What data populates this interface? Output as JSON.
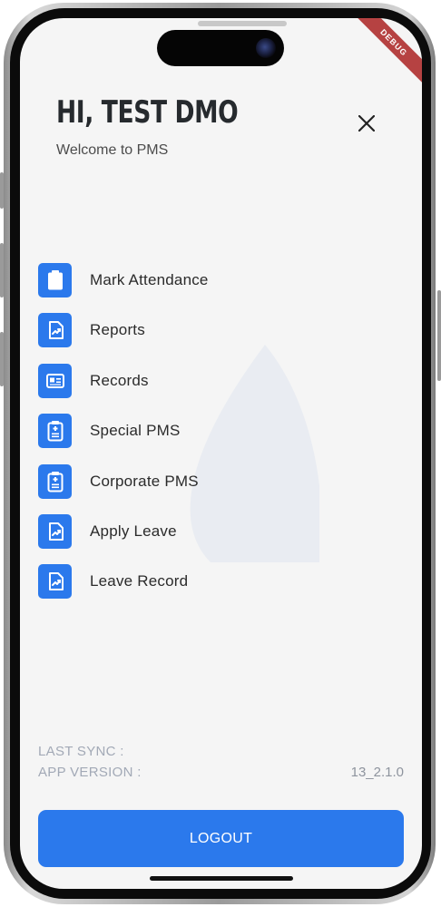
{
  "header": {
    "greeting": "HI, TEST DMO",
    "subtitle": "Welcome to PMS"
  },
  "debug_banner": "DEBUG",
  "menu": {
    "items": [
      {
        "label": "Mark Attendance",
        "icon": "clipboard-icon"
      },
      {
        "label": "Reports",
        "icon": "trend-up-icon"
      },
      {
        "label": "Records",
        "icon": "id-card-icon"
      },
      {
        "label": "Special PMS",
        "icon": "medical-clipboard-icon"
      },
      {
        "label": "Corporate PMS",
        "icon": "medical-clipboard-icon"
      },
      {
        "label": "Apply Leave",
        "icon": "trend-up-icon"
      },
      {
        "label": "Leave Record",
        "icon": "trend-up-icon"
      }
    ]
  },
  "footer": {
    "last_sync_label": "LAST SYNC :",
    "app_version_label": "APP VERSION :",
    "app_version_value": "13_2.1.0",
    "logout_label": "LOGOUT"
  },
  "colors": {
    "accent": "#2b79ec",
    "debug": "#b64242",
    "background": "#f5f5f5"
  }
}
